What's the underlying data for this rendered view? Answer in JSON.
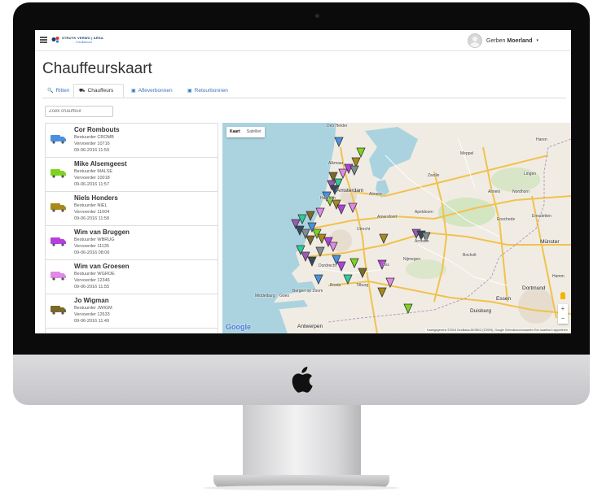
{
  "header": {
    "logo_text": "STRUYK VERWO | ARSA",
    "logo_sub": "Grindladoost",
    "user_first": "Gerben",
    "user_last": "Moerland",
    "user_caret": "▾"
  },
  "page": {
    "title": "Chauffeurskaart"
  },
  "tabs": [
    {
      "label": "Ritten",
      "icon": "🔍",
      "active": false
    },
    {
      "label": "Chauffeurs",
      "icon": "⛟",
      "active": true
    },
    {
      "label": "Afleverbonnen",
      "icon": "▣",
      "active": false
    },
    {
      "label": "Retourbonnen",
      "icon": "▣",
      "active": false
    }
  ],
  "search": {
    "placeholder": "Zoek chauffeur"
  },
  "drivers": [
    {
      "name": "Cor Rombouts",
      "bestuurder": "Bestuurder CROMB",
      "vervoerder": "Vervoerder 10716",
      "date": "09-06-2016 11:59",
      "color": "#4a90e2"
    },
    {
      "name": "Mike Alsemgeest",
      "bestuurder": "Bestuurder MALSE",
      "vervoerder": "Vervoerder 10018",
      "date": "09-06-2016 11:57",
      "color": "#7ed321"
    },
    {
      "name": "Niels Honders",
      "bestuurder": "Bestuurder NIEL",
      "vervoerder": "Vervoerder 11004",
      "date": "09-06-2016 11:58",
      "color": "#a8891a"
    },
    {
      "name": "Wim van Bruggen",
      "bestuurder": "Bestuurder WBRUG",
      "vervoerder": "Vervoerder 11135",
      "date": "09-06-2016 08:06",
      "color": "#b43fe0"
    },
    {
      "name": "Wim van Groesen",
      "bestuurder": "Bestuurder WGROE",
      "vervoerder": "Vervoerder 12346",
      "date": "09-06-2016 11:55",
      "color": "#e089e6"
    },
    {
      "name": "Jo Wigman",
      "bestuurder": "Bestuurder JWIGM",
      "vervoerder": "Vervoerder 12633",
      "date": "09-06-2016 11:49",
      "color": "#7a6a2a"
    }
  ],
  "map": {
    "type_map": "Kaart",
    "type_satellite": "Satelliet",
    "google": "Google",
    "attribution": "Kaartgegevens ©2016 GeoBasis-DE/BKG (©2009), Google   Gebruiksvoorwaarden   Een kaartfout rapporteren",
    "zoom_in": "+",
    "zoom_out": "−",
    "labels": {
      "den_helder": "Den Helder",
      "alkmaar": "Alkmaar",
      "haarlem": "Haarlem",
      "amsterdam": "Amsterdam",
      "almere": "Almere",
      "utrecht": "Utrecht",
      "amersfoort": "Amersfoort",
      "apeldoorn": "Apeldoorn",
      "zwolle": "Zwolle",
      "meppel": "Meppel",
      "almelo": "Almelo",
      "enschede": "Enschede",
      "lingen": "Lingen",
      "nordhorn": "Nordhorn",
      "haren": "Haren",
      "emsdetten": "Emsdetten",
      "munster": "Münster",
      "arnhem": "Arnhem",
      "nijmegen": "Nijmegen",
      "bocholt": "Bocholt",
      "dordrecht": "Dordrecht",
      "breda": "Breda",
      "tilburg": "Tilburg",
      "oss": "Oss",
      "bergen_op_zoom": "Bergen op Zoom",
      "middelburg": "Middelburg",
      "goes": "Goes",
      "antwerpen": "Antwerpen",
      "essen": "Essen",
      "duisburg": "Duisburg",
      "dortmund": "Dortmund",
      "hamm": "Hamm"
    }
  }
}
